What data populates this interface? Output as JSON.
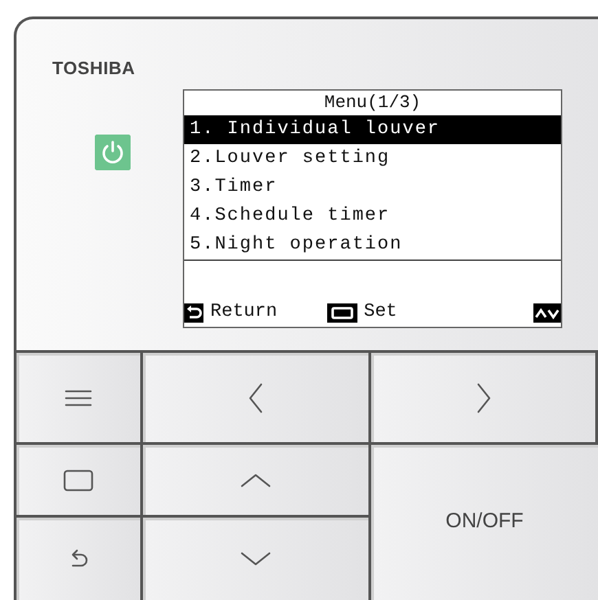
{
  "brand": "TOSHIBA",
  "screen": {
    "title": "Menu(1/3)",
    "items": [
      {
        "label": "1. Individual louver",
        "selected": true
      },
      {
        "label": "2.Louver setting",
        "selected": false
      },
      {
        "label": "3.Timer",
        "selected": false
      },
      {
        "label": "4.Schedule timer",
        "selected": false
      },
      {
        "label": "5.Night operation",
        "selected": false
      }
    ],
    "footer": [
      {
        "kind": "return",
        "label": "Return"
      },
      {
        "kind": "set",
        "label": "Set"
      },
      {
        "kind": "updown"
      }
    ]
  },
  "buttons": [
    {
      "kind": "menu"
    },
    {
      "kind": "left"
    },
    {
      "kind": "right"
    },
    {
      "kind": "set"
    },
    {
      "kind": "up"
    },
    {
      "kind": "on_off",
      "label": "ON/OFF"
    },
    {
      "kind": "return"
    },
    {
      "kind": "down"
    }
  ]
}
